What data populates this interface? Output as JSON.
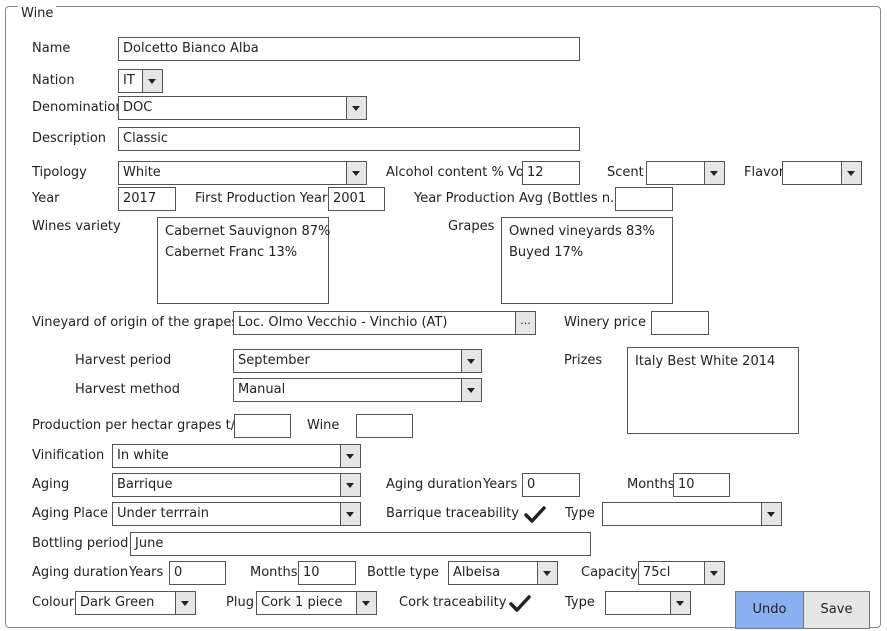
{
  "group_title": "Wine",
  "labels": {
    "name": "Name",
    "nation": "Nation",
    "denomination": "Denomination",
    "description": "Description",
    "tipology": "Tipology",
    "alcohol": "Alcohol content % Vol.",
    "scent": "Scent",
    "flavor": "Flavor",
    "year": "Year",
    "first_year": "First Production Year",
    "year_avg": "Year Production Avg (Bottles n.)",
    "wines_variety": "Wines variety",
    "grapes": "Grapes",
    "vineyard": "Vineyard of origin of the grapes",
    "winery_price": "Winery price",
    "harvest_period": "Harvest period",
    "harvest_method": "Harvest method",
    "prizes": "Prizes",
    "production_per_hectar": "Production per hectar grapes t/h",
    "wine": "Wine",
    "vinification": "Vinification",
    "aging": "Aging",
    "aging_duration": "Aging duration",
    "years": "Years",
    "months": "Months",
    "aging_place": "Aging Place",
    "barrique_traceability": "Barrique traceability",
    "type": "Type",
    "bottling_period": "Bottling period",
    "bottle_type": "Bottle type",
    "capacity": "Capacity",
    "colour": "Colour",
    "plug": "Plug",
    "cork_traceability": "Cork traceability"
  },
  "values": {
    "name": "Dolcetto Bianco Alba",
    "nation": "IT",
    "denomination": "DOC",
    "description": "Classic",
    "tipology": "White",
    "alcohol": "12",
    "scent": "",
    "flavor": "",
    "year": "2017",
    "first_year": "2001",
    "year_avg": "",
    "wines_variety": [
      "Cabernet Sauvignon 87%",
      "Cabernet Franc 13%"
    ],
    "grapes": [
      "Owned vineyards 83%",
      "Buyed 17%"
    ],
    "vineyard": "Loc. Olmo Vecchio - Vinchio (AT)",
    "vineyard_browse": "...",
    "winery_price": "",
    "harvest_period": "September",
    "harvest_method": "Manual",
    "prizes": "Italy Best White 2014",
    "production_per_hectar": "",
    "wine": "",
    "vinification": "In white",
    "aging": "Barrique",
    "aging_years": "0",
    "aging_months": "10",
    "aging_place": "Under terrrain",
    "barrique_type": "",
    "bottling_period": "June",
    "aging2_years": "0",
    "aging2_months": "10",
    "bottle_type": "Albeisa",
    "capacity": "75cl",
    "colour": "Dark Green",
    "plug": "Cork 1 piece",
    "cork_type": ""
  },
  "buttons": {
    "undo": "Undo",
    "save": "Save"
  },
  "colors": {
    "primary_button": "#8ab0f0",
    "secondary_button": "#e6e6e6",
    "border": "#555555"
  }
}
